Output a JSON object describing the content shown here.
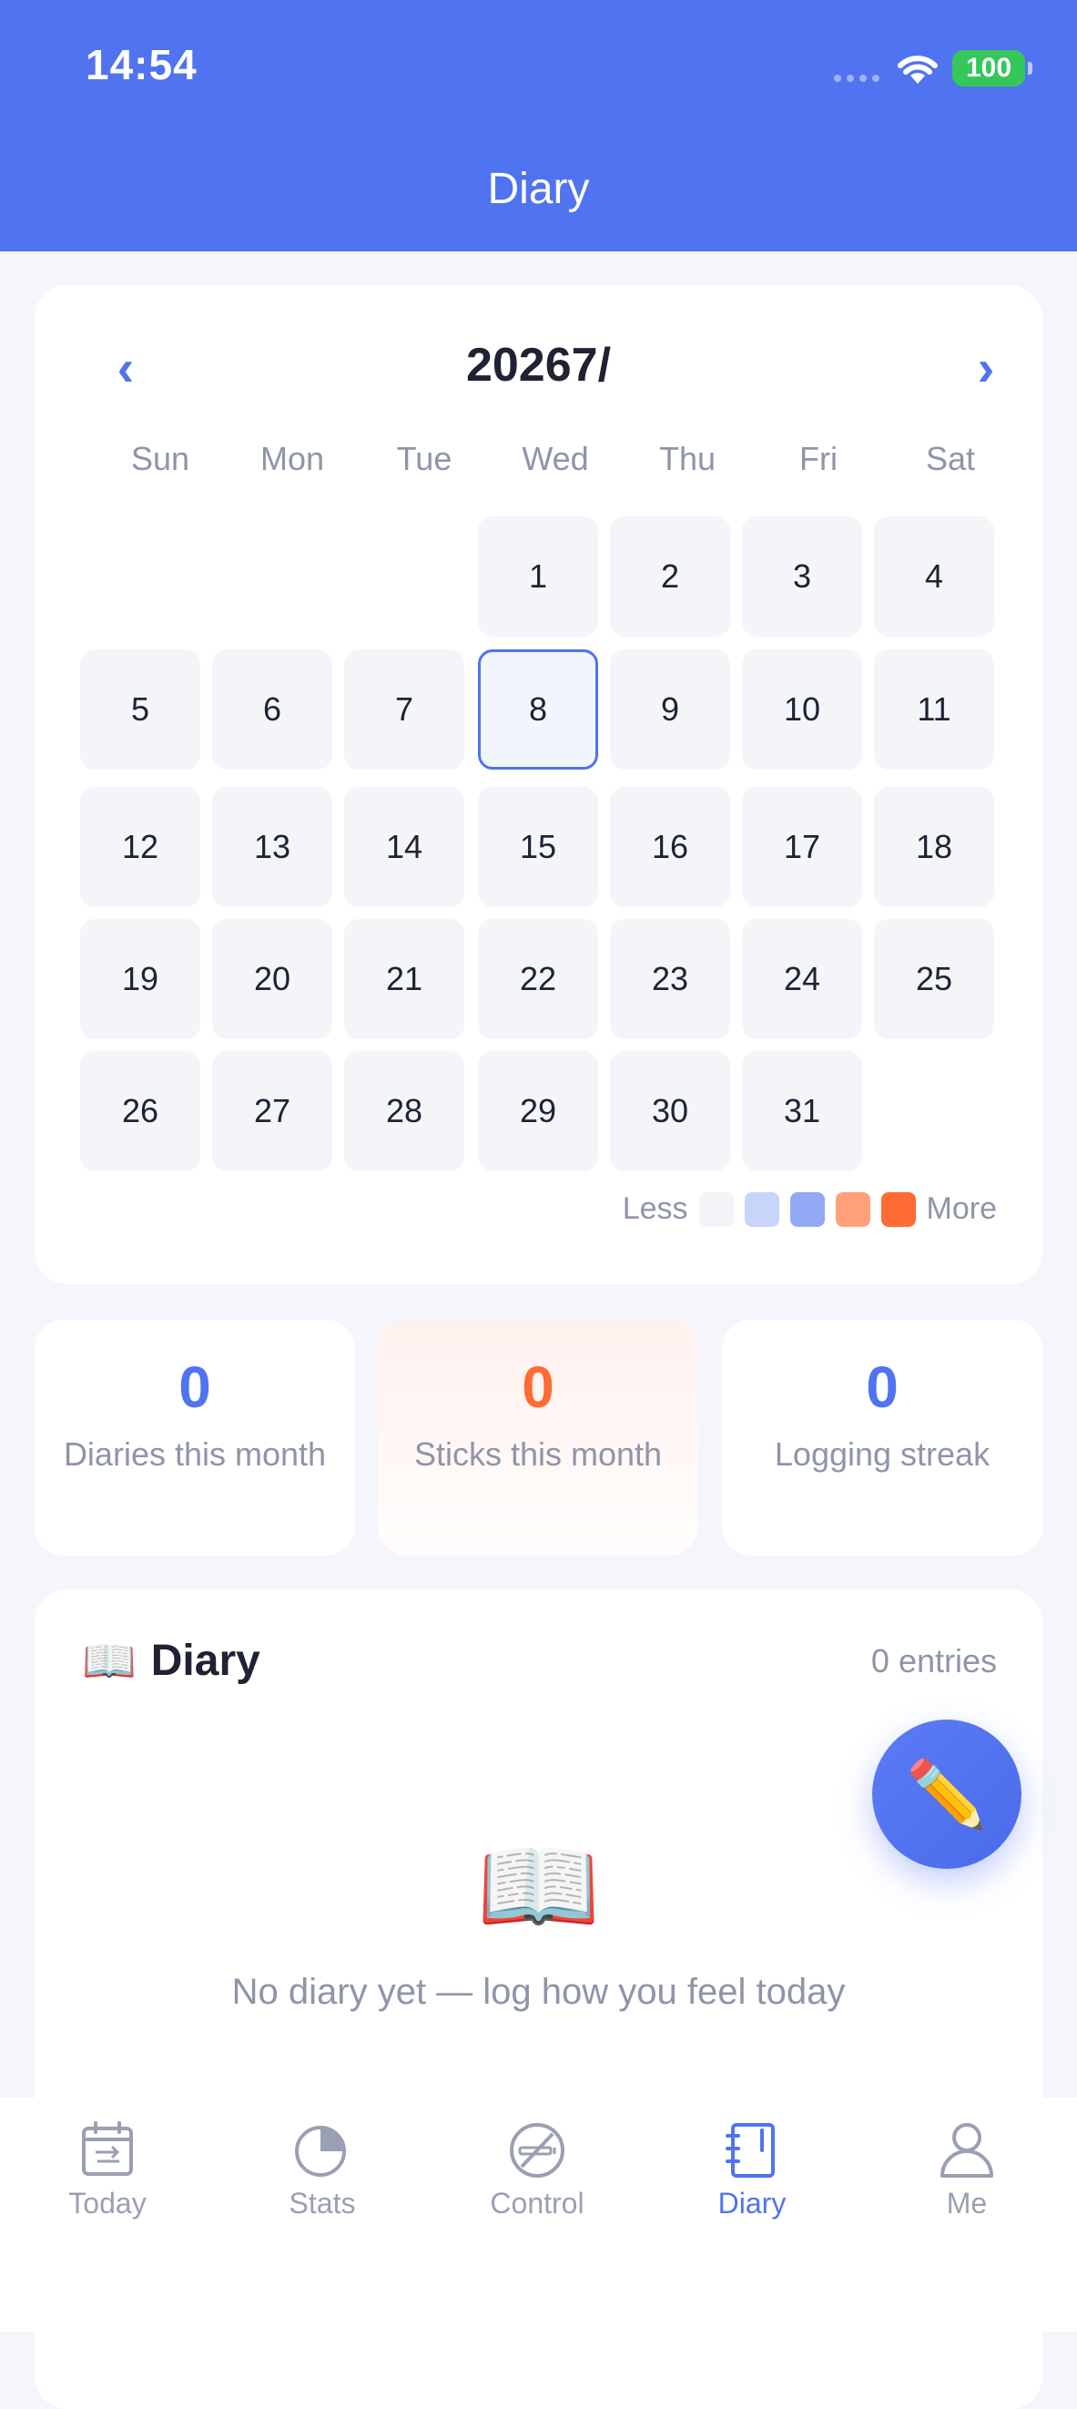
{
  "status_bar": {
    "time": "14:54",
    "battery": "100"
  },
  "header": {
    "title": "Diary"
  },
  "calendar": {
    "month_label": "20267/",
    "prev_symbol": "‹",
    "next_symbol": "›",
    "weekdays": [
      "Sun",
      "Mon",
      "Tue",
      "Wed",
      "Thu",
      "Fri",
      "Sat"
    ],
    "days": [
      "1",
      "2",
      "3",
      "4",
      "5",
      "6",
      "7",
      "8",
      "9",
      "10",
      "11",
      "12",
      "13",
      "14",
      "15",
      "16",
      "17",
      "18",
      "19",
      "20",
      "21",
      "22",
      "23",
      "24",
      "25",
      "26",
      "27",
      "28",
      "29",
      "30",
      "31"
    ],
    "selected_day": "8",
    "legend": {
      "less": "Less",
      "more": "More",
      "colors": [
        "#f3f4f8",
        "#c9d4fb",
        "#93a9f6",
        "#ffa07a",
        "#ff6b33"
      ]
    }
  },
  "stats": [
    {
      "value": "0",
      "label": "Diaries this month"
    },
    {
      "value": "0",
      "label": "Sticks this month"
    },
    {
      "value": "0",
      "label": "Logging streak"
    }
  ],
  "diary": {
    "icon": "📖",
    "title": "Diary",
    "count": "0 entries",
    "empty_icon": "📖",
    "empty_text": "No diary yet — log how you feel today",
    "fab_icon": "✏️"
  },
  "tabs": [
    {
      "label": "Today",
      "icon": "calendar-icon"
    },
    {
      "label": "Stats",
      "icon": "pie-chart-icon"
    },
    {
      "label": "Control",
      "icon": "no-smoking-icon"
    },
    {
      "label": "Diary",
      "icon": "notebook-icon"
    },
    {
      "label": "Me",
      "icon": "user-icon"
    }
  ],
  "colors": {
    "accent": "#5073f0",
    "warm": "#ff6b33",
    "muted": "#8e95a8"
  }
}
